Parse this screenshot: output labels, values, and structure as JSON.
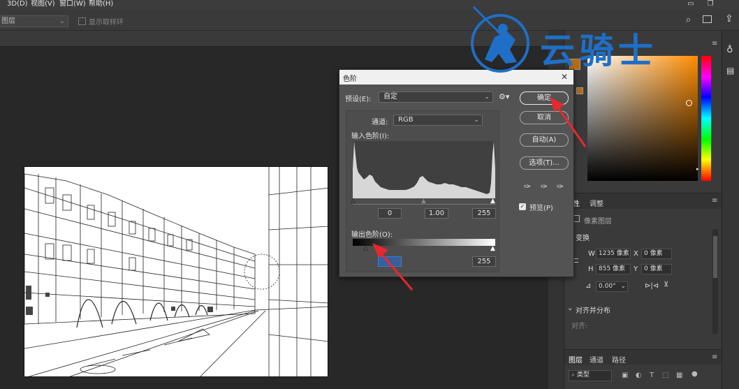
{
  "menu": {
    "items": [
      "3D(D)",
      "视图(V)",
      "窗口(W)",
      "帮助(H)"
    ],
    "cut_left": "层"
  },
  "options_bar": {
    "sample_select": "图层",
    "show_ring_label": "显示取样环"
  },
  "dialog": {
    "title": "色阶",
    "preset_label": "预设(E):",
    "preset_value": "自定",
    "channel_label": "通道:",
    "channel_value": "RGB",
    "input_levels_label": "输入色阶(I):",
    "input_black": "0",
    "input_gamma": "1.00",
    "input_white": "255",
    "output_levels_label": "输出色阶(O):",
    "output_black": "",
    "output_white": "255",
    "buttons": {
      "ok": "确定",
      "cancel": "取消",
      "auto": "自动(A)",
      "options": "选项(T)..."
    },
    "preview_label": "预览(P)",
    "preview_checked": true
  },
  "color_panel": {
    "swatch_fg": "#b86a10",
    "swatch_bg": "#b86a10",
    "hue_color": "#ff8c00"
  },
  "properties_panel": {
    "tabs": [
      "性",
      "调整"
    ],
    "pixel_layer_label": "像素图层",
    "transform_label": "变换",
    "w_label": "W",
    "w_value": "1235 像素",
    "h_label": "H",
    "h_value": "855 像素",
    "x_label": "X",
    "x_value": "0 像素",
    "y_label": "Y",
    "y_value": "0 像素",
    "angle_value": "0.00°",
    "align_label": "对齐并分布",
    "align_sub": "对齐:"
  },
  "layers_panel": {
    "tabs": [
      "图层",
      "通道",
      "路径"
    ],
    "filter_label": "类型"
  },
  "watermark": {
    "text": "云骑士"
  },
  "colors": {
    "accent_blue": "#1f6fc6",
    "arrow_red": "#e8282e"
  }
}
